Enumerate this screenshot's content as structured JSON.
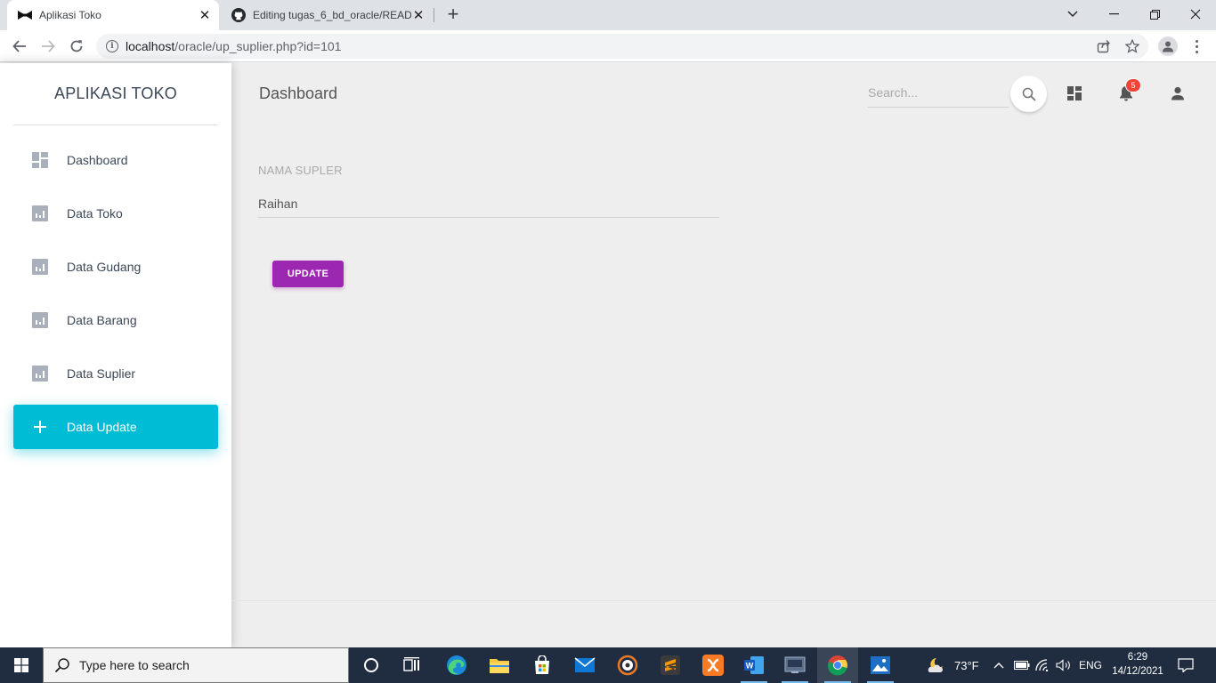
{
  "browser": {
    "tabs": [
      {
        "title": "Aplikasi Toko",
        "active": true
      },
      {
        "title": "Editing tugas_6_bd_oracle/README",
        "active": false
      }
    ],
    "url_host": "localhost",
    "url_path": "/oracle/up_suplier.php?id=101"
  },
  "sidebar": {
    "brand": "APLIKASI TOKO",
    "items": [
      {
        "label": "Dashboard",
        "icon": "dashboard-icon"
      },
      {
        "label": "Data Toko",
        "icon": "bar-chart-icon"
      },
      {
        "label": "Data Gudang",
        "icon": "bar-chart-icon"
      },
      {
        "label": "Data Barang",
        "icon": "bar-chart-icon"
      },
      {
        "label": "Data Suplier",
        "icon": "bar-chart-icon"
      },
      {
        "label": "Data Update",
        "icon": "plus-icon",
        "active": true
      }
    ]
  },
  "navbar": {
    "title": "Dashboard",
    "search_placeholder": "Search...",
    "notification_count": "5"
  },
  "form": {
    "label": "NAMA SUPLER",
    "value": "Raihan",
    "submit_label": "UPDATE"
  },
  "taskbar": {
    "search_placeholder": "Type here to search",
    "weather": "73°F",
    "language": "ENG",
    "time": "6:29",
    "date": "14/12/2021"
  },
  "colors": {
    "active_nav": "#00bcd4",
    "button": "#9c27b0",
    "badge": "#f44336",
    "taskbar": "#202c3f"
  }
}
